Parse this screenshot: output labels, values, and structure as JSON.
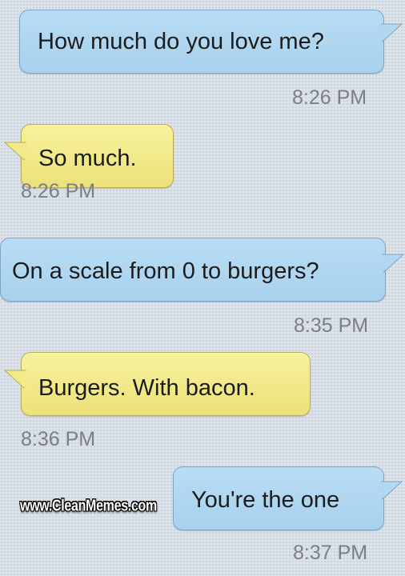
{
  "conversation": {
    "messages": [
      {
        "direction": "sent",
        "text": "How much do you love me?",
        "time": "8:26 PM"
      },
      {
        "direction": "received",
        "text": "So much.",
        "time": "8:26 PM"
      },
      {
        "direction": "sent",
        "text": "On a scale from 0 to burgers?",
        "time": "8:35 PM"
      },
      {
        "direction": "received",
        "text": "Burgers. With bacon.",
        "time": "8:36 PM"
      },
      {
        "direction": "sent",
        "text": "You're the one",
        "time": "8:37 PM"
      }
    ]
  },
  "watermark": {
    "text": "www.CleanMemes.com"
  },
  "colors": {
    "sent_bubble": "#b1d7f1",
    "received_bubble": "#f2ea88",
    "background": "#dbe2ea",
    "timestamp": "#7b7f85"
  }
}
